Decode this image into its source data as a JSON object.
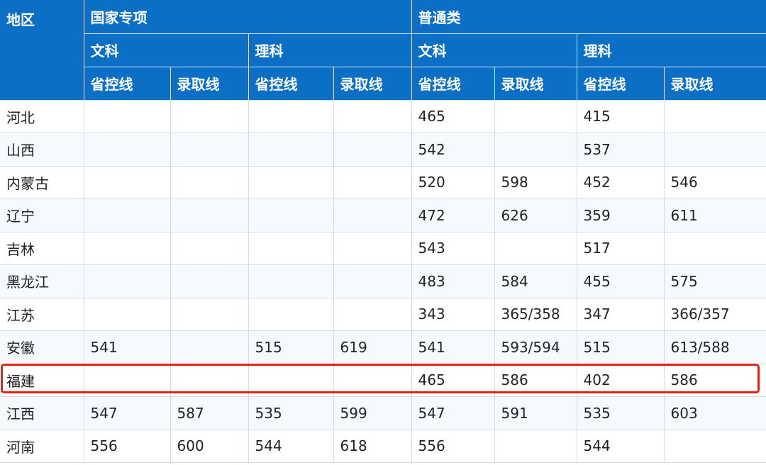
{
  "header": {
    "region": "地区",
    "national_special": "国家专项",
    "general": "普通类",
    "arts": "文科",
    "science": "理科",
    "provincial_line": "省控线",
    "admission_line": "录取线"
  },
  "rows": [
    {
      "region": "河北",
      "cells": [
        "",
        "",
        "",
        "",
        "465",
        "",
        "415",
        ""
      ]
    },
    {
      "region": "山西",
      "cells": [
        "",
        "",
        "",
        "",
        "542",
        "",
        "537",
        ""
      ]
    },
    {
      "region": "内蒙古",
      "cells": [
        "",
        "",
        "",
        "",
        "520",
        "598",
        "452",
        "546"
      ]
    },
    {
      "region": "辽宁",
      "cells": [
        "",
        "",
        "",
        "",
        "472",
        "626",
        "359",
        "611"
      ]
    },
    {
      "region": "吉林",
      "cells": [
        "",
        "",
        "",
        "",
        "543",
        "",
        "517",
        ""
      ]
    },
    {
      "region": "黑龙江",
      "cells": [
        "",
        "",
        "",
        "",
        "483",
        "584",
        "455",
        "575"
      ]
    },
    {
      "region": "江苏",
      "cells": [
        "",
        "",
        "",
        "",
        "343",
        "365/358",
        "347",
        "366/357"
      ]
    },
    {
      "region": "安徽",
      "cells": [
        "541",
        "",
        "515",
        "619",
        "541",
        "593/594",
        "515",
        "613/588"
      ]
    },
    {
      "region": "福建",
      "cells": [
        "",
        "",
        "",
        "",
        "465",
        "586",
        "402",
        "586"
      ]
    },
    {
      "region": "江西",
      "cells": [
        "547",
        "587",
        "535",
        "599",
        "547",
        "591",
        "535",
        "603"
      ]
    },
    {
      "region": "河南",
      "cells": [
        "556",
        "600",
        "544",
        "618",
        "556",
        "",
        "544",
        ""
      ]
    }
  ],
  "highlight": {
    "row": "福建",
    "color": "#e0251b"
  },
  "colors": {
    "header_bg": "#0b6fc5",
    "stripe": "#f6f9fd",
    "highlight": "#e0251b"
  }
}
